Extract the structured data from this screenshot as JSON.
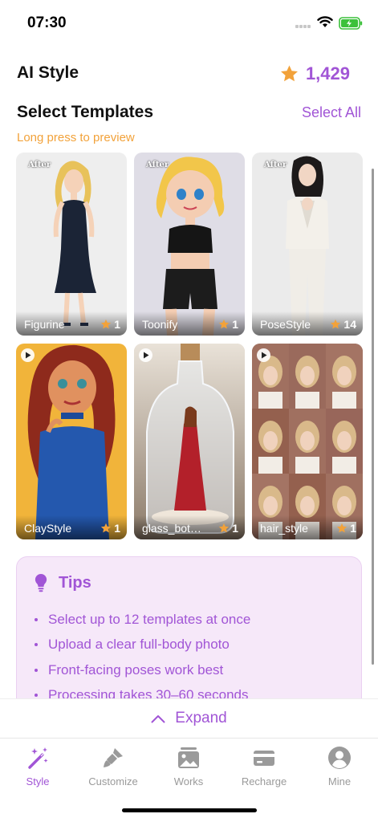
{
  "status_bar": {
    "time": "07:30"
  },
  "header": {
    "title": "AI Style",
    "coins": "1,429",
    "accent": "#a155d6",
    "star_color": "#f2a23a"
  },
  "templates_section": {
    "title": "Select Templates",
    "select_all": "Select All",
    "hint": "Long press to preview"
  },
  "templates": [
    {
      "name": "Figurine",
      "cost": "1",
      "badge": "After",
      "type": "image"
    },
    {
      "name": "Toonify",
      "cost": "1",
      "badge": "After",
      "type": "image"
    },
    {
      "name": "PoseStyle",
      "cost": "14",
      "badge": "After",
      "type": "image"
    },
    {
      "name": "ClayStyle",
      "cost": "1",
      "badge": "",
      "type": "video"
    },
    {
      "name": "glass_bot…",
      "cost": "1",
      "badge": "",
      "type": "video"
    },
    {
      "name": "hair_style",
      "cost": "1",
      "badge": "",
      "type": "video"
    }
  ],
  "tips": {
    "title": "Tips",
    "items": [
      "Select up to 12 templates at once",
      "Upload a clear full-body photo",
      "Front-facing poses work best",
      "Processing takes 30–60 seconds"
    ]
  },
  "expand": {
    "label": "Expand"
  },
  "tab_bar": {
    "active": "Style",
    "tabs": [
      {
        "label": "Style",
        "icon": "magic-wand-icon"
      },
      {
        "label": "Customize",
        "icon": "brush-icon"
      },
      {
        "label": "Works",
        "icon": "gallery-icon"
      },
      {
        "label": "Recharge",
        "icon": "card-icon"
      },
      {
        "label": "Mine",
        "icon": "person-icon"
      }
    ]
  }
}
